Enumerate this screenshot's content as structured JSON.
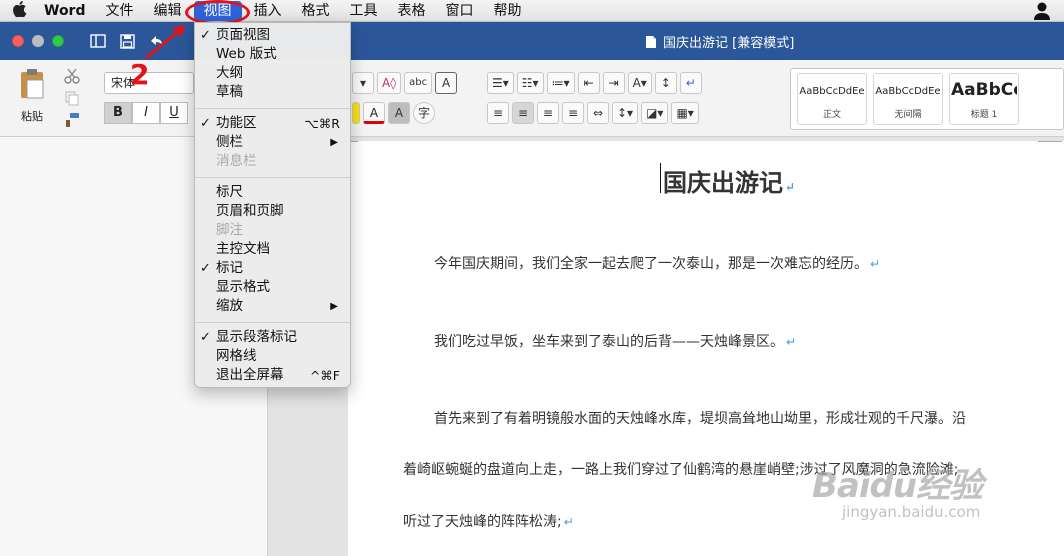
{
  "menubar": {
    "app": "Word",
    "items": [
      "文件",
      "编辑",
      "视图",
      "插入",
      "格式",
      "工具",
      "表格",
      "窗口",
      "帮助"
    ],
    "active_index": 2
  },
  "titlebar": {
    "doc_title": "国庆出游记 [兼容模式]"
  },
  "ribbon": {
    "paste_label": "粘贴",
    "font_name": "宋体",
    "bold": "B",
    "italic": "I",
    "underline": "U",
    "styles": [
      {
        "sample": "AaBbCcDdEe",
        "name": "正文"
      },
      {
        "sample": "AaBbCcDdEe",
        "name": "无间隔"
      },
      {
        "sample": "AaBbCc",
        "name": "标题 1"
      }
    ]
  },
  "view_menu": {
    "groups": [
      [
        {
          "label": "页面视图",
          "checked": true
        },
        {
          "label": "Web 版式"
        },
        {
          "label": "大纲"
        },
        {
          "label": "草稿"
        }
      ],
      [
        {
          "label": "功能区",
          "checked": true,
          "shortcut": "⌥⌘R"
        },
        {
          "label": "侧栏",
          "submenu": true
        },
        {
          "label": "消息栏",
          "disabled": true
        }
      ],
      [
        {
          "label": "标尺"
        },
        {
          "label": "页眉和页脚"
        },
        {
          "label": "脚注",
          "disabled": true
        },
        {
          "label": "主控文档"
        },
        {
          "label": "标记",
          "checked": true
        },
        {
          "label": "显示格式"
        },
        {
          "label": "缩放",
          "submenu": true
        }
      ],
      [
        {
          "label": "显示段落标记",
          "checked": true
        },
        {
          "label": "网格线"
        },
        {
          "label": "退出全屏幕",
          "shortcut": "^⌘F"
        }
      ]
    ]
  },
  "annotation": {
    "number": "2"
  },
  "document": {
    "title": "国庆出游记",
    "paragraphs": [
      "今年国庆期间，我们全家一起去爬了一次泰山，那是一次难忘的经历。",
      "我们吃过早饭，坐车来到了泰山的后背——天烛峰景区。",
      "首先来到了有着明镜般水面的天烛峰水库，堤坝高耸地山坳里，形成壮观的千尺瀑。沿",
      "着崎岖蜿蜒的盘道向上走，一路上我们穿过了仙鹤湾的悬崖峭壁;涉过了风魔洞的急流险滩;",
      "听过了天烛峰的阵阵松涛;"
    ],
    "para_mark": "↵"
  },
  "watermark": {
    "logo": "Baidu经验",
    "url": "jingyan.baidu.com"
  }
}
